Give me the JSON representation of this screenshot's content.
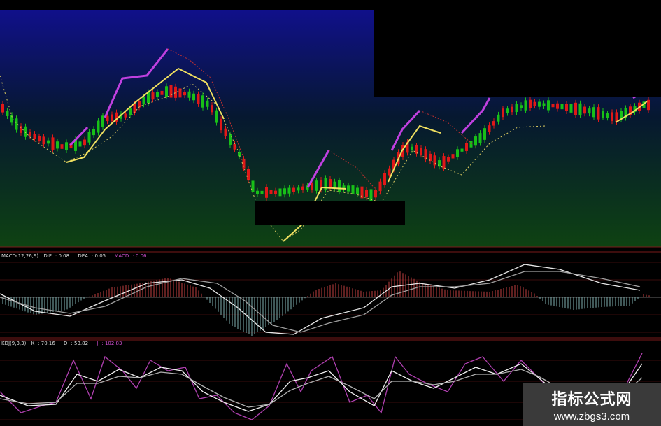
{
  "chart_data": [
    {
      "type": "candlestick",
      "panel": "price",
      "overlays": [
        "upper-band-magenta",
        "middle-line-yellow",
        "dotted-lower-band"
      ],
      "colors": {
        "up": "#e01818",
        "down": "#18c018",
        "upper_band": "#c040e0",
        "middle_line": "#f0e060",
        "lower_band": "#d8c860"
      }
    },
    {
      "type": "line+bar",
      "panel": "macd",
      "label": "MACD(12,26,9)",
      "readouts": [
        {
          "name": "DIF",
          "value": "0.08"
        },
        {
          "name": "DEA",
          "value": "0.05"
        },
        {
          "name": "MACD",
          "value": "0.06"
        }
      ],
      "colors": {
        "dif": "#e8e8e8",
        "dea": "#a0a0a0",
        "pos_bar": "#c04040",
        "neg_bar": "#80b0b0"
      }
    },
    {
      "type": "line",
      "panel": "kdj",
      "label": "KDJ(9,3,3)",
      "readouts": [
        {
          "name": "K",
          "value": "70.16"
        },
        {
          "name": "D",
          "value": "53.82"
        },
        {
          "name": "J",
          "value": "102.83"
        }
      ],
      "colors": {
        "k": "#f0f0f0",
        "d": "#b0b0b0",
        "j": "#b040b0"
      }
    }
  ],
  "watermark": {
    "title": "指标公式网",
    "url": "www.zbgs3.com"
  }
}
